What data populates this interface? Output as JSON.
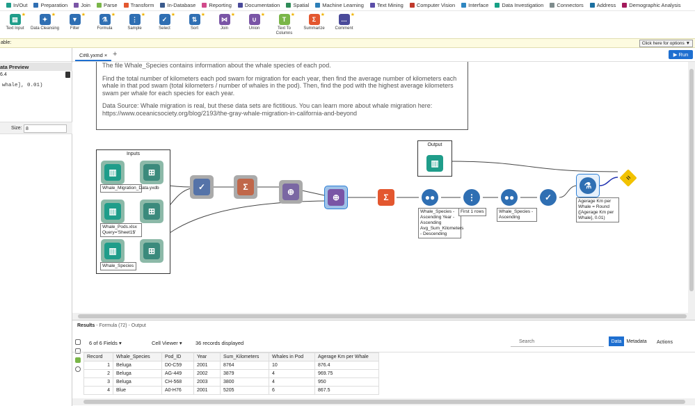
{
  "categories": [
    {
      "label": "In/Out",
      "color": "#1f9d8a"
    },
    {
      "label": "Preparation",
      "color": "#2f6fb3"
    },
    {
      "label": "Join",
      "color": "#7a55a6"
    },
    {
      "label": "Parse",
      "color": "#7ab648"
    },
    {
      "label": "Transform",
      "color": "#e3572f"
    },
    {
      "label": "In-Database",
      "color": "#3a5a8c"
    },
    {
      "label": "Reporting",
      "color": "#d14a8b"
    },
    {
      "label": "Documentation",
      "color": "#4a4a9a"
    },
    {
      "label": "Spatial",
      "color": "#2e8b57"
    },
    {
      "label": "Machine Learning",
      "color": "#2c7fb8"
    },
    {
      "label": "Text Mining",
      "color": "#5b4ea8"
    },
    {
      "label": "Computer Vision",
      "color": "#c0392b"
    },
    {
      "label": "Interface",
      "color": "#2e86c1"
    },
    {
      "label": "Data Investigation",
      "color": "#16a085"
    },
    {
      "label": "Connectors",
      "color": "#7f8c8d"
    },
    {
      "label": "Address",
      "color": "#1b6fa0"
    },
    {
      "label": "Demographic Analysis",
      "color": "#a3195b"
    }
  ],
  "tools": [
    {
      "label": "Text Input",
      "color": "#1f9d8a",
      "glyph": "▤"
    },
    {
      "label": "Data Cleansing",
      "color": "#2f6fb3",
      "glyph": "✦"
    },
    {
      "label": "Filter",
      "color": "#2f6fb3",
      "glyph": "▼"
    },
    {
      "label": "Formula",
      "color": "#2f6fb3",
      "glyph": "⚗"
    },
    {
      "label": "Sample",
      "color": "#2f6fb3",
      "glyph": "⋮"
    },
    {
      "label": "Select",
      "color": "#2f6fb3",
      "glyph": "✓"
    },
    {
      "label": "Sort",
      "color": "#2f6fb3",
      "glyph": "⇅"
    },
    {
      "label": "Join",
      "color": "#7a55a6",
      "glyph": "⋈"
    },
    {
      "label": "Union",
      "color": "#7a55a6",
      "glyph": "∪"
    },
    {
      "label": "Text To Columns",
      "color": "#7ab648",
      "glyph": "T"
    },
    {
      "label": "Summarize",
      "color": "#e3572f",
      "glyph": "Σ"
    },
    {
      "label": "Comment",
      "color": "#4a4a9a",
      "glyph": "…"
    }
  ],
  "optbar": {
    "left_text": "able:",
    "button": "Click here for options ▼"
  },
  "left_panel": {
    "title": "ata Preview",
    "version": "6.4",
    "code": "whale], 0.01)",
    "size_label": "Size:",
    "size_value": "8"
  },
  "tab": {
    "name": "C#8.yxmd ×",
    "plus": "+",
    "run": "▶ Run"
  },
  "comment": {
    "line1": "The file Whale_Species contains information about the whale species of each pod.",
    "line2": "Find the total number of kilometers each pod swam for migration for each year, then find the average number of kilometers each whale in that pod swam (total kilometers / number of whales in the pod). Then, find the pod with the highest average kilometers swam per whale for each species for each year.",
    "line3": "Data Source: Whale migration is real, but these data sets are fictitious. You can learn more about whale migration here: https://www.oceanicsociety.org/blog/2193/the-gray-whale-migration-in-california-and-beyond"
  },
  "workflow": {
    "inputs_title": "Inputs",
    "output_title": "Output",
    "label_input1": "Whale_Migration_Data.yxdb",
    "label_input2": "Whale_Pods.xlsx Query='Sheet1$'",
    "label_input3": "Whale_Species",
    "label_sort1": "Whale_Species - Ascending Year - Ascending Avg_Sum_Kilometers - Descending",
    "label_sample": "First 1 rows",
    "label_sort2": "Whale_Species - Ascending",
    "label_formula": "Agerage Km per Whale = Round ([Agerage Km per Whale], 0.01)"
  },
  "results": {
    "title_prefix": "Results",
    "title_rest": " - Formula (72) - Output",
    "fields": "6 of 6 Fields ▾",
    "viewer": "Cell Viewer ▾",
    "records": "36 records displayed",
    "search": "Search",
    "data_btn": "Data",
    "meta_btn": "Metadata",
    "actions": "Actions",
    "columns": [
      "Record",
      "Whale_Species",
      "Pod_ID",
      "Year",
      "Sum_Kilometers",
      "Whales in Pod",
      "Agerage Km per Whale"
    ],
    "rows": [
      [
        "1",
        "Beluga",
        "D0-C59",
        "2001",
        "8764",
        "10",
        "876.4"
      ],
      [
        "2",
        "Beluga",
        "AG-449",
        "2002",
        "3879",
        "4",
        "969.75"
      ],
      [
        "3",
        "Beluga",
        "CH-568",
        "2003",
        "3800",
        "4",
        "950"
      ],
      [
        "4",
        "Blue",
        "A0-H76",
        "2001",
        "5205",
        "6",
        "867.5"
      ]
    ]
  }
}
